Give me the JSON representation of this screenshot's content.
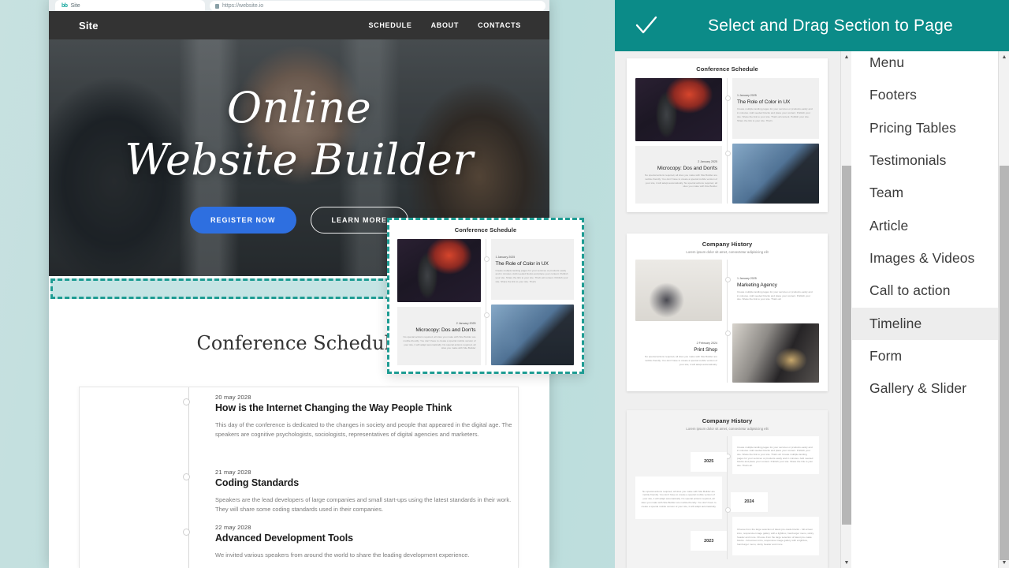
{
  "browser": {
    "tab_favicon": "bb",
    "tab_title": "Site",
    "url": "https://website.io"
  },
  "site_preview": {
    "nav": {
      "logo": "Site",
      "links": [
        "SCHEDULE",
        "ABOUT",
        "CONTACTS"
      ]
    },
    "hero": {
      "line1": "Online",
      "line2": "Website Builder",
      "primary_button": "REGISTER NOW",
      "secondary_button": "LEARN MORE"
    },
    "section_heading": "Conference Schedule",
    "timeline": [
      {
        "date": "20 may 2028",
        "title": "How is the Internet Changing the Way People Think",
        "desc": "This day of the conference is dedicated to the changes in society and people that appeared in the digital age. The speakers are cognitive psychologists, sociologists, representatives of digital agencies and marketers."
      },
      {
        "date": "21 may 2028",
        "title": "Coding Standards",
        "desc": "Speakers are the lead developers of large companies and small start-ups using the latest standards in their work. They will share some coding standards used in their companies."
      },
      {
        "date": "22 may 2028",
        "title": "Advanced Development Tools",
        "desc": "We invited various speakers from around the world to share the leading development experience."
      }
    ]
  },
  "drag_ghost": {
    "heading": "Conference Schedule",
    "cards": [
      {
        "date": "1 January 2025",
        "title": "The Role of Color in UX",
        "body": "Create multiple landing pages for your services or products easily and in minutes. Add needed blocks and place your content. Publish your site. Share the link to your site. That's all content. Publish your site. Share the link to your site. That's"
      },
      {
        "date": "2 January 2025",
        "title": "Microcopy: Dos and Don'ts",
        "body": "No special actions required, all sites you make with Site Builder are mobile-friendly. You don't have to create a special mobile version of your site, it will adapt automatically. No special actions required, all sites you make with Site Builder"
      }
    ]
  },
  "panel": {
    "title": "Select and  Drag Section to  Page",
    "check_icon": "check-icon",
    "accent_color": "#0b8b88"
  },
  "thumbnails": [
    {
      "heading": "Conference Schedule",
      "subtitle": "",
      "cards": [
        {
          "date": "1 January 2025",
          "title": "The Role of Color in UX",
          "body": "Create multiple landing pages for your services or products easily and in minutes. Add needed blocks and place your content. Publish your site. Share the link to your site. That's all content. Publish your site. Share the link to your site. That's"
        },
        {
          "date": "2 January 2025",
          "title": "Microcopy: Dos and Don'ts",
          "body": "No special actions required, all sites you make with Site Builder are mobile-friendly. You don't have to create a special mobile version of your site, it will adapt automatically. No special actions required, all sites you make with Site Builder"
        }
      ]
    },
    {
      "heading": "Company History",
      "subtitle": "Lorem ipsum dolor sit amet, consectetur adipisicing elit",
      "cards": [
        {
          "date": "1 January 2025",
          "title": "Marketing Agency",
          "body": "Create multiple landing pages for your services or products easily and in minutes. Add needed blocks and place your content. Publish your site. Share the link to your site. That's all."
        },
        {
          "date": "2 February 2024",
          "title": "Print Shop",
          "body": "No special actions required, all sites you make with Site Builder are mobile-friendly. You don't have to create a special mobile version of your site, it will adapt automatically."
        }
      ]
    },
    {
      "heading": "Company History",
      "subtitle": "Lorem ipsum dolor sit amet, consectetur adipisicing elit",
      "years": [
        "2025",
        "2024",
        "2023"
      ],
      "bodies": [
        "Create multiple landing pages for your services or products easily and in minutes. Add needed blocks and place your content. Publish your site. Share the link to your site. That's all. Create multiple landing pages for your services or products easily and in minutes. Add needed blocks and place your content. Publish your site. Share the link to your site. That's all.",
        "No special actions required, all sites you make with Site Builder are mobile-friendly. You don't have to create a special mobile version of your site, it will adapt automatically. No special actions required, all sites you make with Site Builder are mobile-friendly. You don't have to create a special mobile version of your site, it will adapt automatically.",
        "Choose from the large selection of latest pre-made blocks - full-screen intro, responsive image gallery with a lightbox, hamburger menu, sticky header and more. Choose from the large selection of latest pre-made blocks - full-screen intro, responsive image gallery with a lightbox, hamburger menu, sticky header and more."
      ]
    }
  ],
  "section_list": {
    "items": [
      {
        "label": "Menu",
        "active": false
      },
      {
        "label": "Footers",
        "active": false
      },
      {
        "label": "Pricing Tables",
        "active": false
      },
      {
        "label": "Testimonials",
        "active": false
      },
      {
        "label": "Team",
        "active": false
      },
      {
        "label": "Article",
        "active": false
      },
      {
        "label": "Images & Videos",
        "active": false
      },
      {
        "label": "Call to action",
        "active": false
      },
      {
        "label": "Timeline",
        "active": true
      },
      {
        "label": "Form",
        "active": false
      },
      {
        "label": "Gallery & Slider",
        "active": false
      }
    ]
  },
  "scrollbars": {
    "up_arrow": "▲",
    "down_arrow": "▼"
  }
}
